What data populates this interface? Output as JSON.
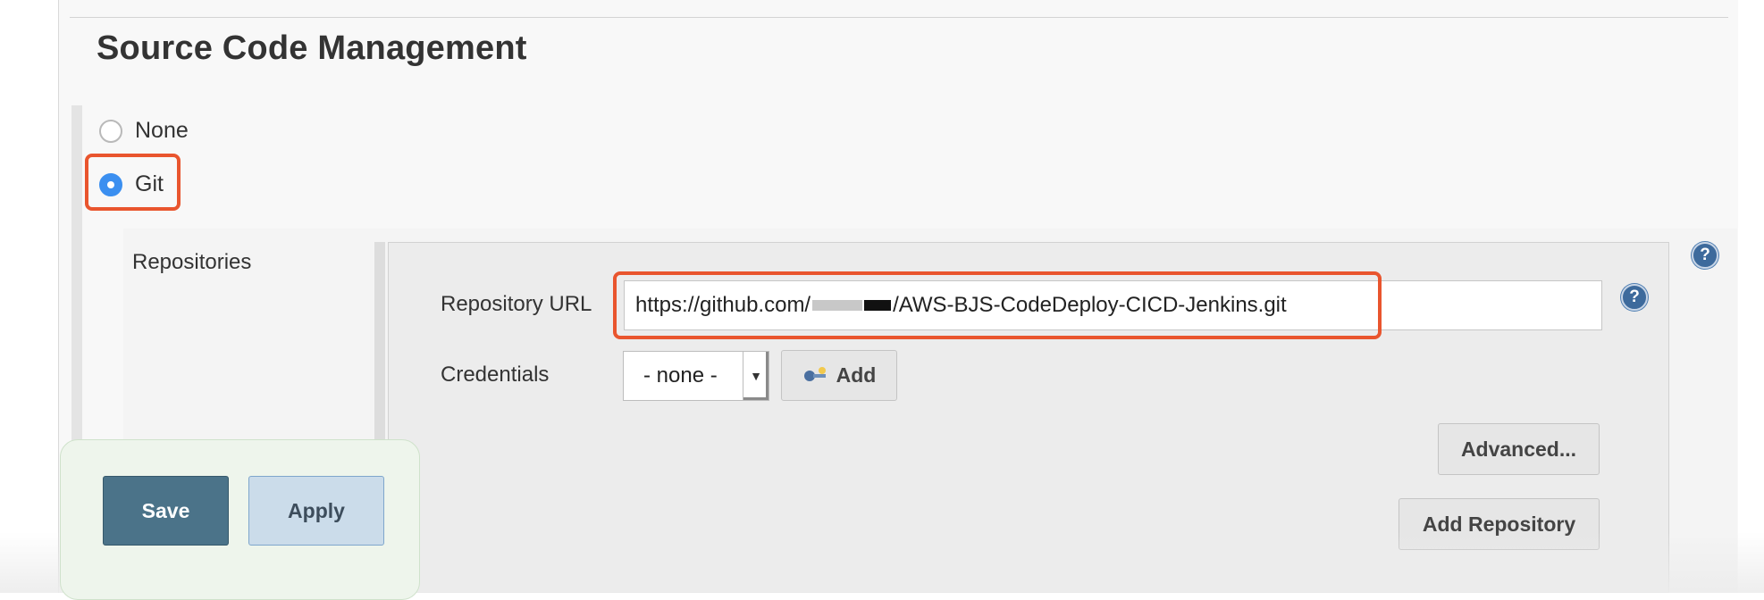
{
  "section": {
    "title": "Source Code Management"
  },
  "scm": {
    "options": [
      {
        "label": "None",
        "selected": false
      },
      {
        "label": "Git",
        "selected": true
      }
    ]
  },
  "repositories": {
    "label": "Repositories",
    "repository_url_label": "Repository URL",
    "repository_url_value_prefix": "https://github.com/",
    "repository_url_value_suffix": "/AWS-BJS-CodeDeploy-CICD-Jenkins.git",
    "credentials_label": "Credentials",
    "credentials_selected": "- none -",
    "add_button": "Add",
    "advanced_button": "Advanced...",
    "add_repository_button": "Add Repository",
    "help_symbol": "?"
  },
  "actions": {
    "save": "Save",
    "apply": "Apply"
  },
  "colors": {
    "highlight": "#e9552e",
    "radio_selected": "#3b8ff0",
    "save_button": "#4b7389",
    "apply_button": "#cbdcea",
    "help_icon": "#3d6a9c"
  },
  "icons": [
    "help-icon",
    "key-icon",
    "dropdown-caret-icon"
  ]
}
